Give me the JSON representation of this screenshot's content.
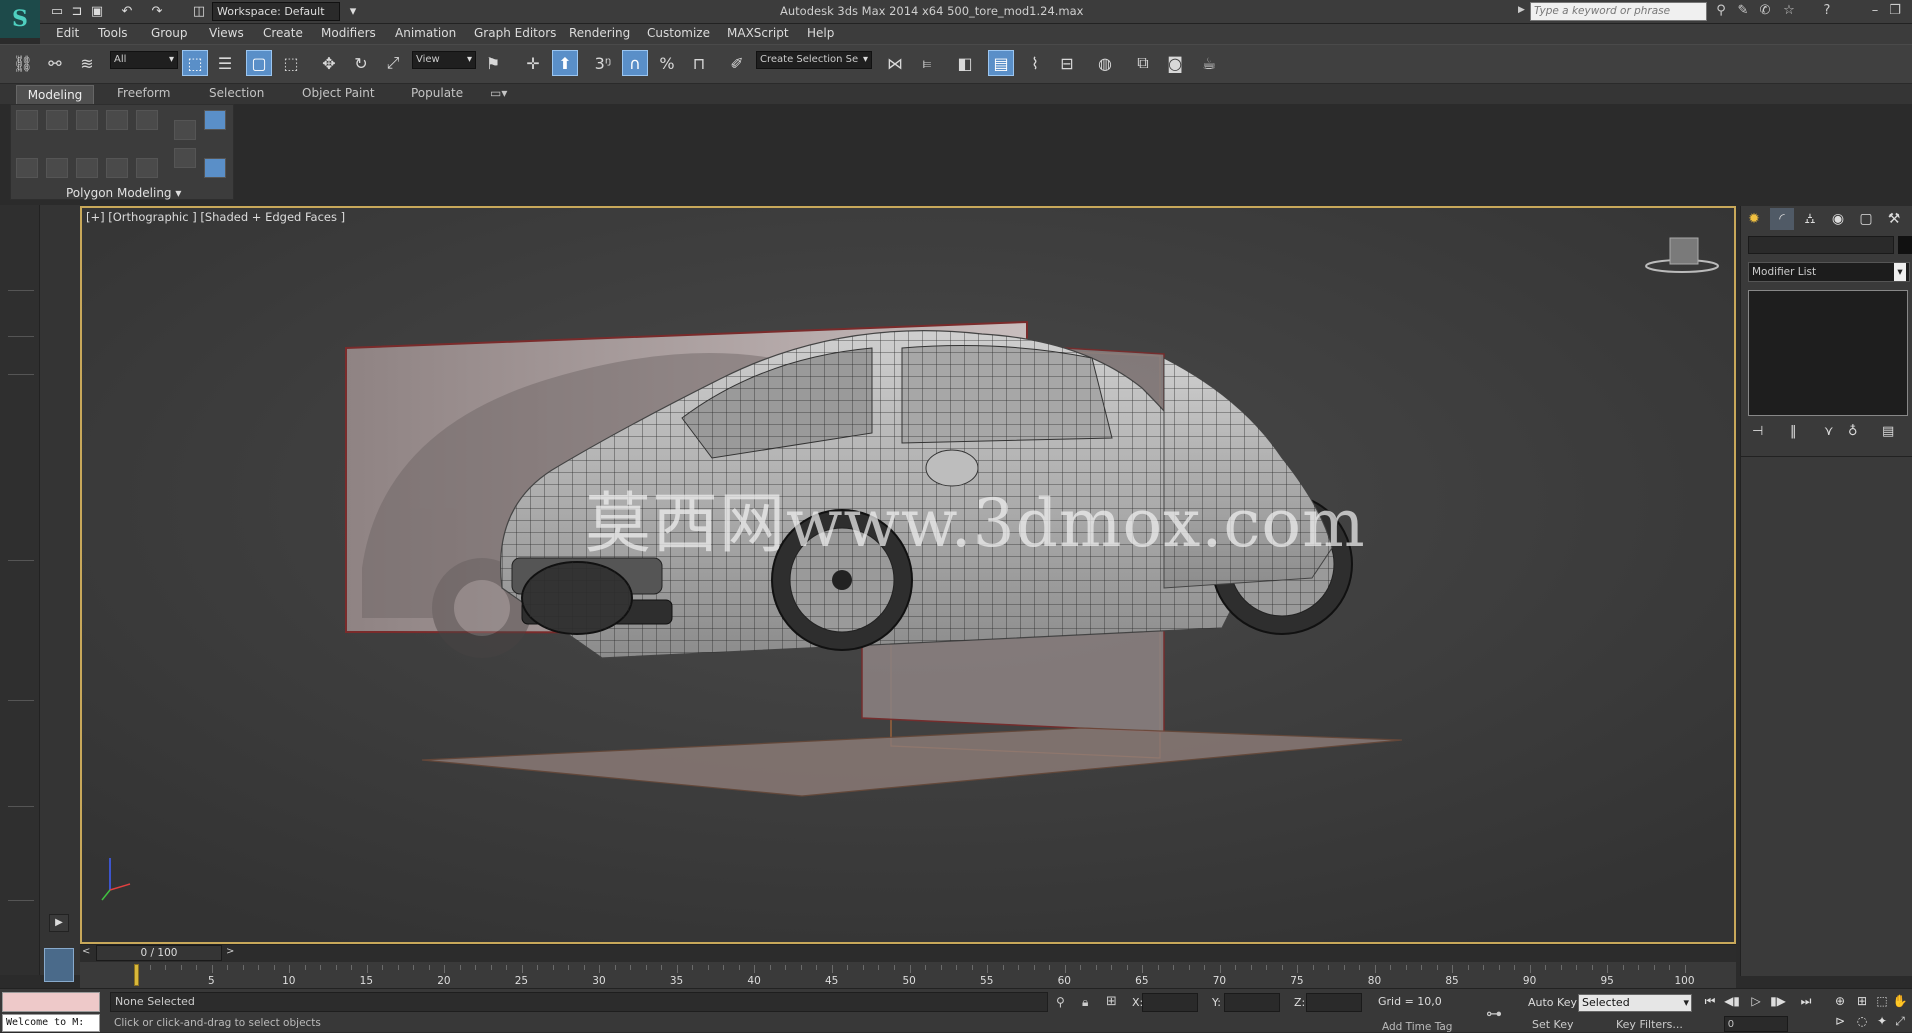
{
  "titlebar": {
    "workspace": "Workspace: Default",
    "app_title": "Autodesk 3ds Max  2014 x64     500_tore_mod1.24.max",
    "search_placeholder": "Type a keyword or phrase"
  },
  "menu": [
    "Edit",
    "Tools",
    "Group",
    "Views",
    "Create",
    "Modifiers",
    "Animation",
    "Graph Editors",
    "Rendering",
    "Customize",
    "MAXScript",
    "Help"
  ],
  "toolbar": {
    "filter_value": "All",
    "ref_coord_value": "View",
    "named_selection_value": "Create Selection Se",
    "snap_angle_label": "3",
    "percent_label": "%"
  },
  "ribbon": {
    "tabs": [
      "Modeling",
      "Freeform",
      "Selection",
      "Object Paint",
      "Populate"
    ],
    "panel_label": "Polygon Modeling"
  },
  "viewport": {
    "label": "[+] [Orthographic ] [Shaded + Edged Faces ]",
    "watermark": "莫西网www.3dmox.com"
  },
  "command_panel": {
    "modifier_list": "Modifier List"
  },
  "timeline": {
    "frame_display": "0 / 100",
    "ticks": [
      "5",
      "10",
      "15",
      "20",
      "25",
      "30",
      "35",
      "40",
      "45",
      "50",
      "55",
      "60",
      "65",
      "70",
      "75",
      "80",
      "85",
      "90",
      "95",
      "100"
    ],
    "current_frame": 0,
    "total_frames": 100
  },
  "status": {
    "welcome": "Welcome to M:",
    "selection": "None Selected",
    "prompt": "Click or click-and-drag to select objects",
    "x_label": "X:",
    "y_label": "Y:",
    "z_label": "Z:",
    "grid": "Grid = 10,0",
    "auto_key": "Auto Key",
    "set_key": "Set Key",
    "key_mode": "Selected",
    "key_filters": "Key Filters...",
    "add_time_tag": "Add Time Tag",
    "frame_field": "0"
  },
  "colors": {
    "viewport_border": "#c8a85a",
    "active_tool": "#5a8fc8",
    "viewport_bg": "#3d3d3d"
  }
}
